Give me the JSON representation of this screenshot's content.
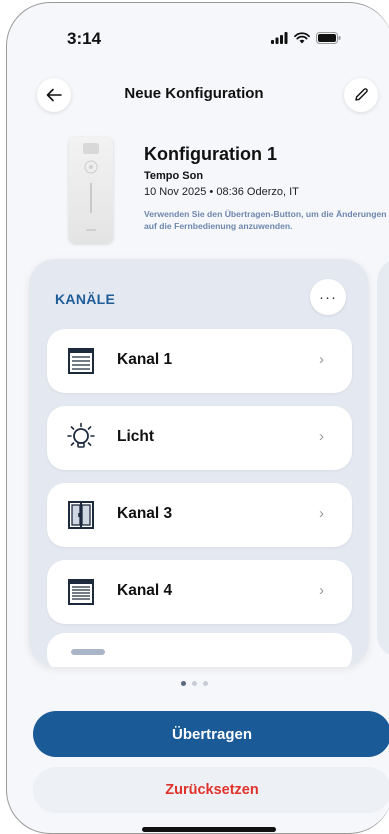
{
  "status": {
    "time": "3:14"
  },
  "header": {
    "title": "Neue Konfiguration"
  },
  "config": {
    "name": "Konfiguration 1",
    "device": "Tempo Son",
    "meta": "10 Nov 2025 • 08:36  Oderzo, IT",
    "hint": "Verwenden Sie den Übertragen-Button, um die Änderungen auf die Fernbedienung anzuwenden."
  },
  "channels": {
    "title": "KANÄLE",
    "more_label": "···",
    "items": [
      {
        "label": "Kanal 1",
        "icon": "roller-shutter-icon"
      },
      {
        "label": "Licht",
        "icon": "light-bulb-icon"
      },
      {
        "label": "Kanal 3",
        "icon": "window-icon"
      },
      {
        "label": "Kanal 4",
        "icon": "roller-shutter-icon"
      }
    ],
    "chevron": "›"
  },
  "pagination": {
    "count": 3,
    "active": 1
  },
  "actions": {
    "primary_label": "Übertragen",
    "secondary_label": "Zurücksetzen"
  },
  "colors": {
    "accent": "#1a5a97",
    "danger": "#e0322a",
    "section_title": "#1f5d99"
  }
}
